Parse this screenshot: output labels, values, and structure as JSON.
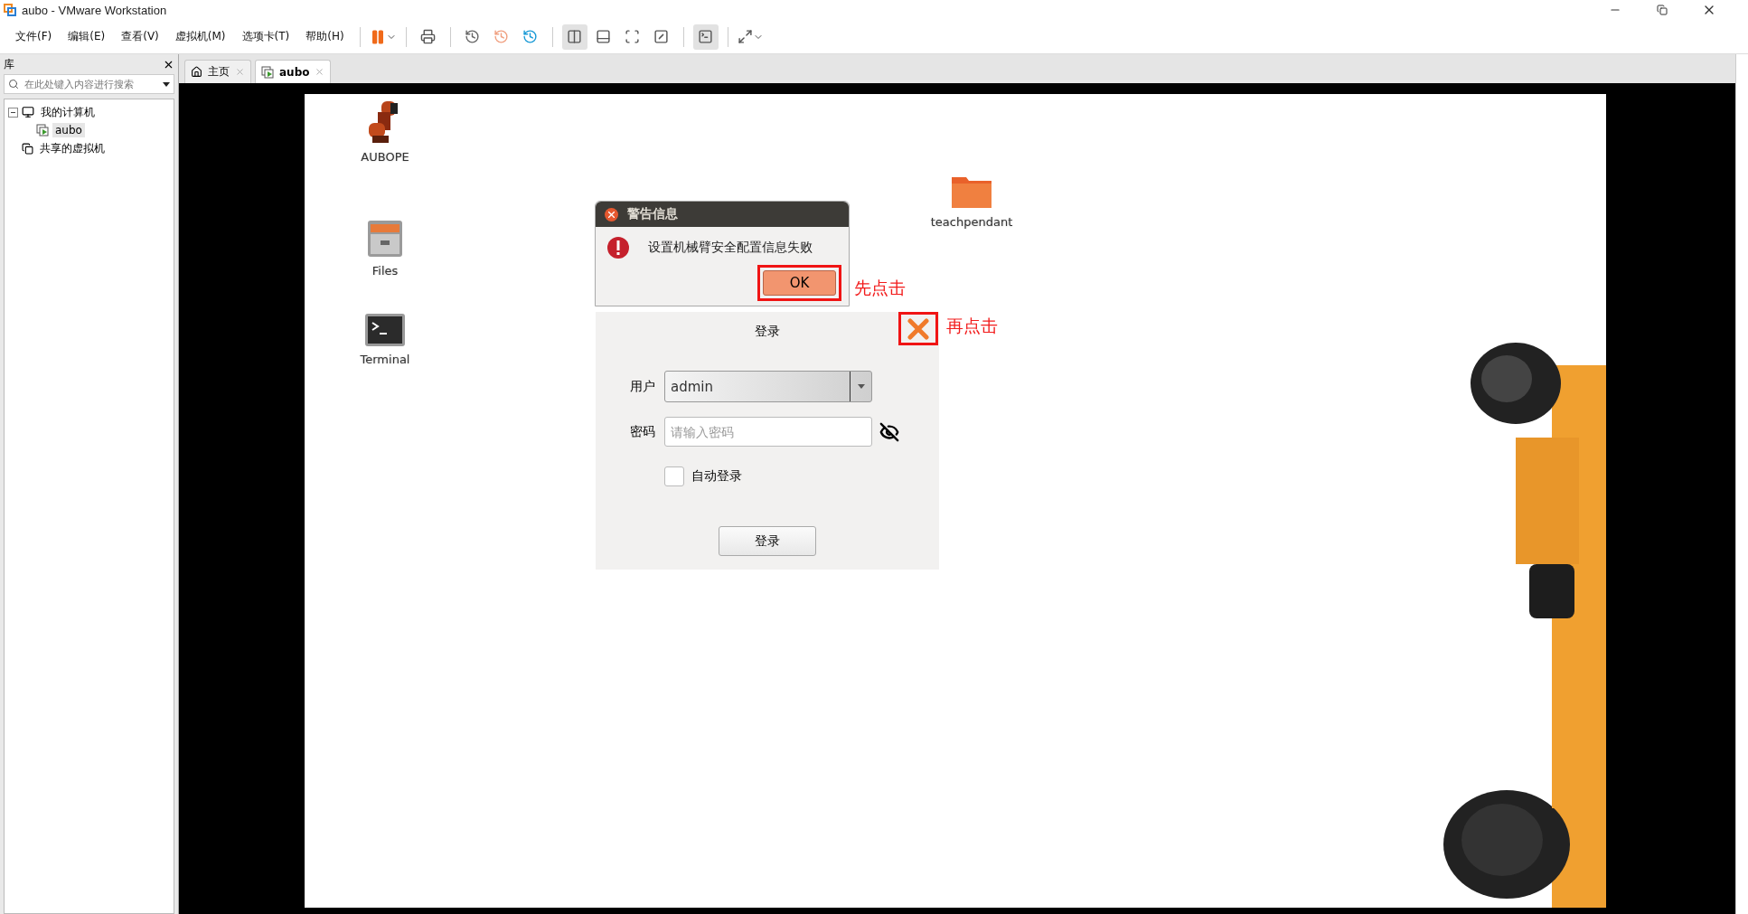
{
  "window": {
    "title": "aubo - VMware Workstation"
  },
  "menu": [
    "文件(F)",
    "编辑(E)",
    "查看(V)",
    "虚拟机(M)",
    "选项卡(T)",
    "帮助(H)"
  ],
  "library": {
    "title": "库",
    "search_placeholder": "在此处键入内容进行搜索",
    "tree": [
      {
        "label": "我的计算机",
        "kind": "computer",
        "selected": false,
        "expanded": true,
        "children": [
          {
            "label": "aubo",
            "kind": "vm",
            "selected": true
          }
        ]
      },
      {
        "label": "共享的虚拟机",
        "kind": "shared",
        "selected": false
      }
    ]
  },
  "tabs": [
    {
      "label": "主页",
      "kind": "home",
      "selected": false
    },
    {
      "label": "aubo",
      "kind": "vm",
      "selected": true
    }
  ],
  "desktop": {
    "icons": [
      {
        "label": "AUBOPE",
        "kind": "robot"
      },
      {
        "label": "Files",
        "kind": "files"
      },
      {
        "label": "Terminal",
        "kind": "terminal"
      },
      {
        "label": "teachpendant",
        "kind": "folder"
      }
    ]
  },
  "alert": {
    "title": "警告信息",
    "message": "设置机械臂安全配置信息失败",
    "button": "OK"
  },
  "login": {
    "title": "登录",
    "user_label": "用户",
    "user_value": "admin",
    "password_label": "密码",
    "password_placeholder": "请输入密码",
    "auto_login": {
      "label": "自动登录",
      "checked": false
    },
    "button": "登录"
  },
  "annotations": [
    {
      "text": "先点击"
    },
    {
      "text": "再点击"
    }
  ]
}
